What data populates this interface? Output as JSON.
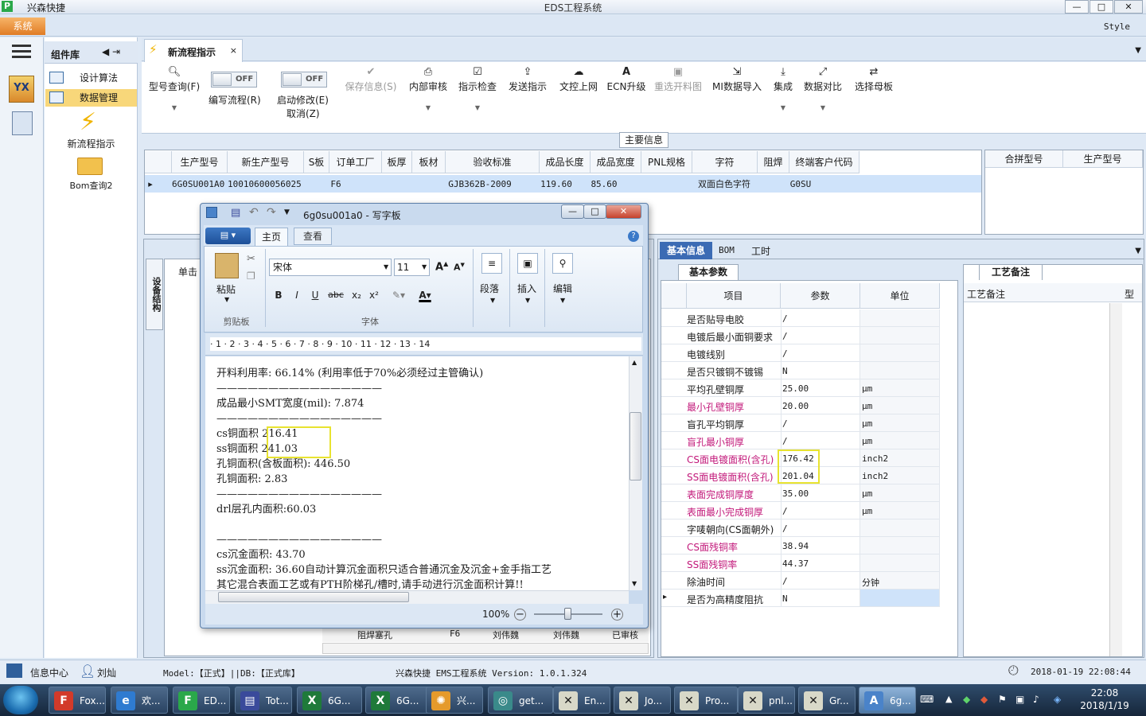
{
  "app": {
    "name": "兴森快捷",
    "window_title": "EDS工程系统",
    "style_label": "Style",
    "system_menu": "系统",
    "window_buttons": [
      "—",
      "□",
      "✕"
    ]
  },
  "left_panel": {
    "title": "组件库",
    "arrows": "◀ ⇥",
    "items": [
      {
        "label": "设计算法"
      },
      {
        "label": "数据管理"
      }
    ],
    "new_flow": "新流程指示",
    "bom_query": "Bom查询2"
  },
  "tabs": [
    {
      "label": "新流程指示",
      "close": "×"
    }
  ],
  "toolbar": {
    "items": [
      {
        "label": "型号查询(F)",
        "icon": "search-icon",
        "disabled": false
      },
      {
        "label": "保存信息(S)",
        "icon": "check-icon",
        "disabled": true
      },
      {
        "label": "内部审核",
        "icon": "print-icon",
        "disabled": false
      },
      {
        "label": "指示检查",
        "icon": "checkbox-icon",
        "disabled": false
      },
      {
        "label": "发送指示",
        "icon": "upload-icon",
        "disabled": false
      },
      {
        "label": "文控上网",
        "icon": "cloud-upload-icon",
        "disabled": false
      },
      {
        "label": "ECN升级",
        "icon": "text-a-icon",
        "disabled": false
      },
      {
        "label": "重选开料图",
        "icon": "image-icon",
        "disabled": true
      },
      {
        "label": "MI数据导入",
        "icon": "import-icon",
        "disabled": false
      },
      {
        "label": "集成",
        "icon": "download-icon",
        "disabled": false
      },
      {
        "label": "数据对比",
        "icon": "compare-icon",
        "disabled": false
      },
      {
        "label": "选择母板",
        "icon": "shuffle-icon",
        "disabled": false
      }
    ],
    "toggle_write": {
      "state": "OFF",
      "label": "编写流程(R)"
    },
    "toggle_start": {
      "state": "OFF",
      "label": "启动修改(E)",
      "label2": "取消(Z)"
    }
  },
  "main_info": {
    "section_title": "主要信息",
    "columns": [
      "生产型号",
      "新生产型号",
      "S板",
      "订单工厂",
      "板厚",
      "板材",
      "验收标准",
      "成品长度",
      "成品宽度",
      "PNL规格",
      "字符",
      "阻焊",
      "终端客户代码"
    ],
    "row": [
      "6G0SU001A0",
      "10010600056025",
      "",
      "F6",
      "",
      "",
      "GJB362B-2009",
      "119.60",
      "85.60",
      "",
      "双面白色字符",
      "",
      "G0SU"
    ],
    "right_columns": [
      "合拼型号",
      "生产型号"
    ]
  },
  "lower_left": {
    "vertical_tab": "设备结构",
    "click_hint": "单击",
    "behind_row": [
      "阻焊塞孔",
      "F6",
      "刘伟魏",
      "刘伟魏",
      "已审核"
    ]
  },
  "info_panel": {
    "tabs": [
      "基本信息",
      "BOM",
      "工时"
    ],
    "param_tab": "基本参数",
    "process_tab": "工艺备注",
    "process_col": "工艺备注",
    "process_col2": "型",
    "columns": [
      "项目",
      "参数",
      "单位"
    ],
    "rows": [
      {
        "item": "是否贴导电胶",
        "value": "/",
        "unit": "",
        "pink": false
      },
      {
        "item": "电镀后最小面铜要求",
        "value": "/",
        "unit": "",
        "pink": false
      },
      {
        "item": "电镀线别",
        "value": "/",
        "unit": "",
        "pink": false
      },
      {
        "item": "是否只镀铜不镀锡",
        "value": "N",
        "unit": "",
        "pink": false
      },
      {
        "item": "平均孔壁铜厚",
        "value": "25.00",
        "unit": "μm",
        "pink": false
      },
      {
        "item": "最小孔壁铜厚",
        "value": "20.00",
        "unit": "μm",
        "pink": true
      },
      {
        "item": "盲孔平均铜厚",
        "value": "/",
        "unit": "μm",
        "pink": false
      },
      {
        "item": "盲孔最小铜厚",
        "value": "/",
        "unit": "μm",
        "pink": true
      },
      {
        "item": "CS面电镀面积(含孔)",
        "value": "176.42",
        "unit": "inch2",
        "pink": true
      },
      {
        "item": "SS面电镀面积(含孔)",
        "value": "201.04",
        "unit": "inch2",
        "pink": true
      },
      {
        "item": "表面完成铜厚度",
        "value": "35.00",
        "unit": "μm",
        "pink": true
      },
      {
        "item": "表面最小完成铜厚",
        "value": "/",
        "unit": "μm",
        "pink": true
      },
      {
        "item": "字唛朝向(CS面朝外)",
        "value": "/",
        "unit": "",
        "pink": false
      },
      {
        "item": "CS面残铜率",
        "value": "38.94",
        "unit": "",
        "pink": true
      },
      {
        "item": "SS面残铜率",
        "value": "44.37",
        "unit": "",
        "pink": true
      },
      {
        "item": "除油时间",
        "value": "/",
        "unit": "分钟",
        "pink": false
      },
      {
        "item": "是否为高精度阻抗",
        "value": "N",
        "unit": "",
        "pink": false
      }
    ]
  },
  "statusbar": {
    "info_center": "信息中心",
    "user": "刘灿",
    "model": "Model:【正式】||DB:【正式库】",
    "system": "兴森快捷 EMS工程系统 Version: 1.0.1.324",
    "datetime": "2018-01-19 22:08:44"
  },
  "wordpad": {
    "title": "6g0su001a0 - 写字板",
    "tab_home": "主页",
    "tab_view": "查看",
    "font_name": "宋体",
    "font_size": "11",
    "groups": {
      "clipboard": "剪贴板",
      "font": "字体",
      "paragraph": "段落",
      "insert": "插入",
      "edit": "编辑"
    },
    "paste": "粘贴",
    "format_buttons": [
      "B",
      "I",
      "U",
      "abc",
      "x₂",
      "x²"
    ],
    "ruler": "· 1 · 2 · 3 · 4 · 5 · 6 · 7 · 8 · 9 · 10 · 11 · 12 · 13 · 14",
    "lines": [
      "开料利用率: 66.14% (利用率低于70%必须经过主管确认)",
      "————————————————",
      "成品最小SMT宽度(mil): 7.874",
      "————————————————",
      "cs铜面积  216.41",
      "ss铜面积  241.03",
      "孔铜面积(含板面积): 446.50",
      "孔铜面积: 2.83",
      "————————————————",
      "drl层孔内面积:60.03",
      "",
      "————————————————",
      "cs沉金面积: 43.70",
      "ss沉金面积: 36.60自动计算沉金面积只适合普通沉金及沉金+金手指工艺",
      "其它混合表面工艺或有PTH阶梯孔/槽时,请手动进行沉金面积计算!!"
    ],
    "zoom": "100%"
  },
  "taskbar": {
    "items": [
      "Fox...",
      "欢...",
      "ED...",
      "Tot...",
      "6G...",
      "6G...",
      "兴...",
      "get...",
      "En...",
      "Jo...",
      "Pro...",
      "pnl...",
      "Gr...",
      "6g..."
    ],
    "time": "22:08",
    "date": "2018/1/19"
  }
}
